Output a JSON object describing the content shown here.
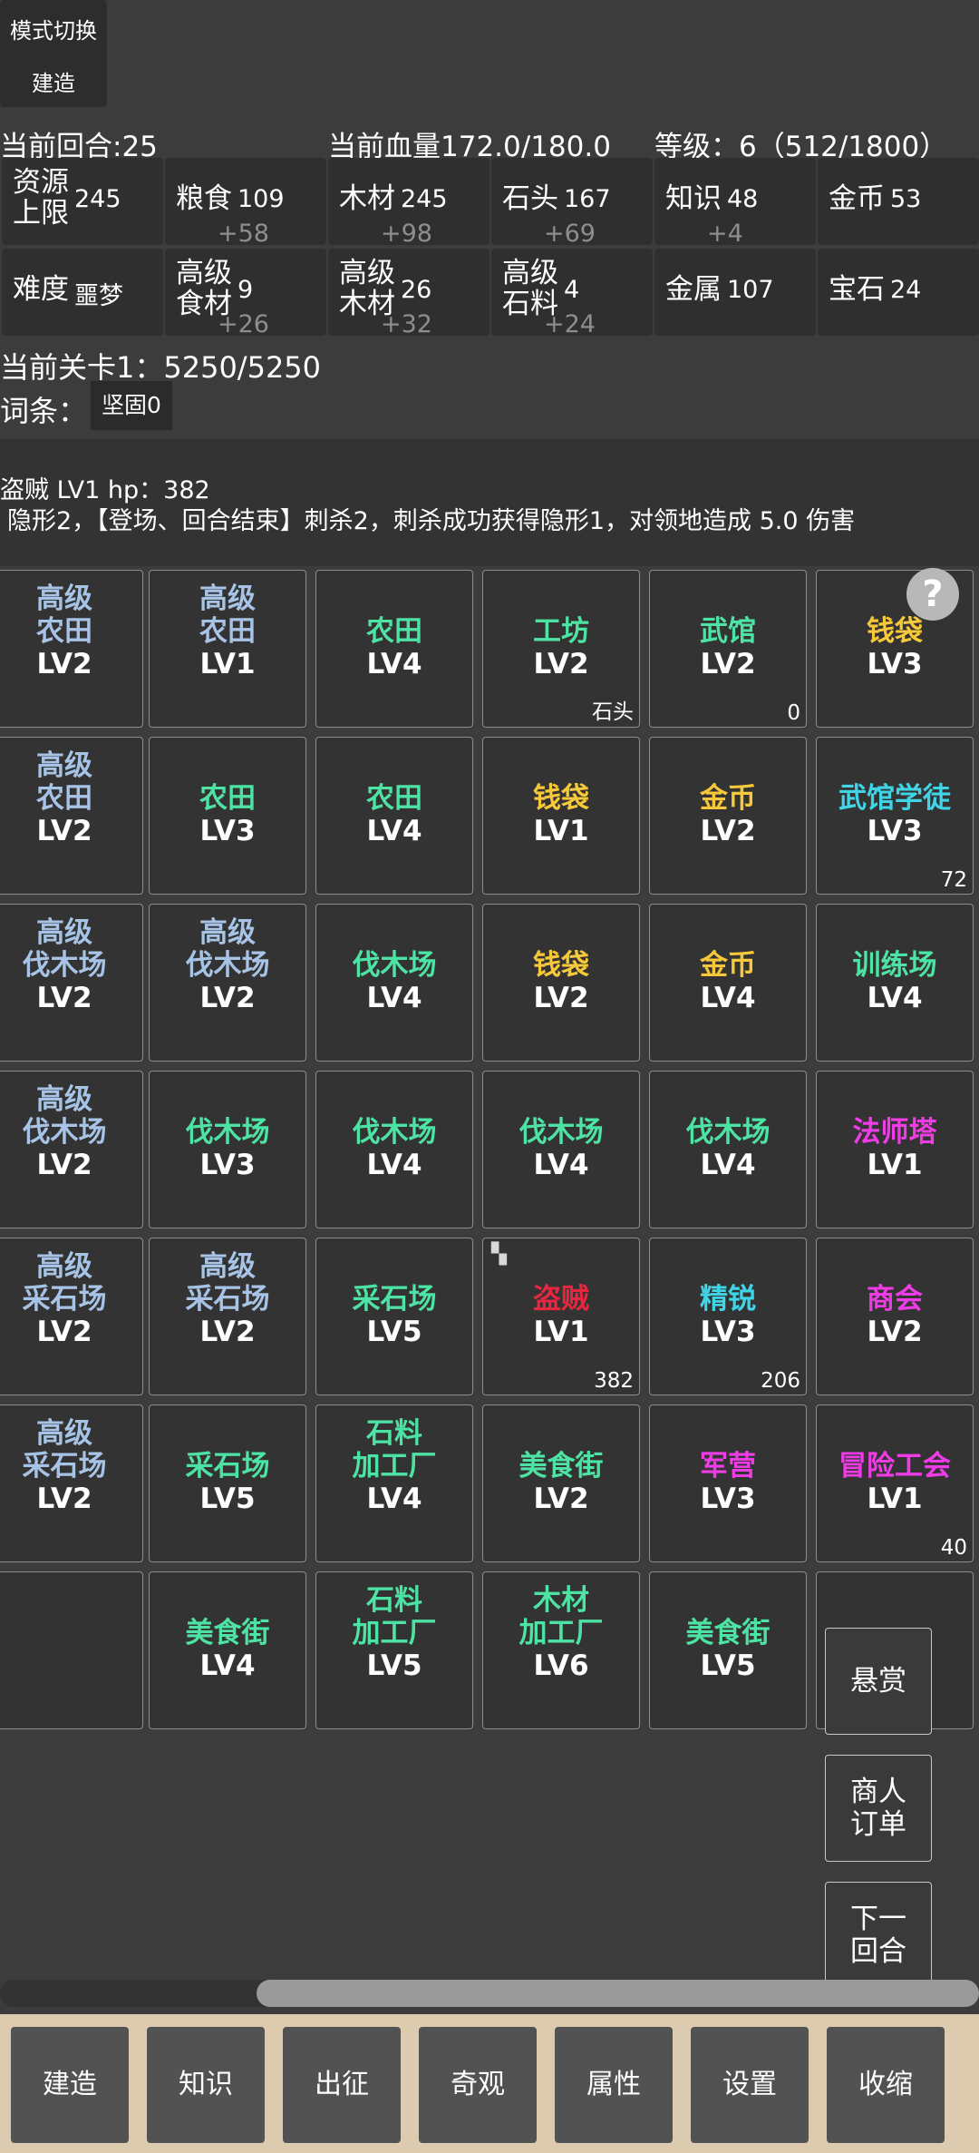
{
  "mode_panel": {
    "title": "模式切换",
    "mode": "建造"
  },
  "status": {
    "round": "当前回合:25",
    "hp": "当前血量172.0/180.0",
    "level": "等级：6（512/1800）"
  },
  "resources": {
    "row1": [
      {
        "label_l1": "资源",
        "label_l2": "上限",
        "value": "245",
        "delta": ""
      },
      {
        "label_l1": "粮食",
        "label_l2": "",
        "value": "109",
        "delta": "+58"
      },
      {
        "label_l1": "木材",
        "label_l2": "",
        "value": "245",
        "delta": "+98"
      },
      {
        "label_l1": "石头",
        "label_l2": "",
        "value": "167",
        "delta": "+69"
      },
      {
        "label_l1": "知识",
        "label_l2": "",
        "value": "48",
        "delta": "+4"
      },
      {
        "label_l1": "金币",
        "label_l2": "",
        "value": "53",
        "delta": ""
      }
    ],
    "row2": [
      {
        "label_l1": "难度",
        "label_l2": "",
        "value": "噩梦",
        "delta": ""
      },
      {
        "label_l1": "高级",
        "label_l2": "食材",
        "value": "9",
        "delta": "+26"
      },
      {
        "label_l1": "高级",
        "label_l2": "木材",
        "value": "26",
        "delta": "+32"
      },
      {
        "label_l1": "高级",
        "label_l2": "石料",
        "value": "4",
        "delta": "+24"
      },
      {
        "label_l1": "金属",
        "label_l2": "",
        "value": "107",
        "delta": ""
      },
      {
        "label_l1": "宝石",
        "label_l2": "",
        "value": "24",
        "delta": ""
      }
    ]
  },
  "stage": {
    "label": "当前关卡1：5250/5250",
    "terms_label": "词条：",
    "term": "坚固0"
  },
  "enemy": {
    "title": "盗贼 LV1 hp：382",
    "desc": "隐形2，【登场、回合结束】刺杀2，刺杀成功获得隐形1，对领地造成 5.0 伤害"
  },
  "help_icon": "question-icon",
  "colors": {
    "blue": "#a7c3e6",
    "green": "#4de3a4",
    "cyan": "#3fd4e6",
    "yellow": "#f7c93a",
    "magenta": "#f03ce6",
    "red": "#e7263f",
    "bottom_bar": "#dccbae"
  },
  "grid": {
    "rows": [
      [
        {
          "l1": "高级",
          "l2": "农田",
          "lv": "LV2",
          "color": "blue",
          "badge": ""
        },
        {
          "l1": "高级",
          "l2": "农田",
          "lv": "LV1",
          "color": "blue",
          "badge": ""
        },
        {
          "l1": "",
          "l2": "农田",
          "lv": "LV4",
          "color": "green",
          "badge": ""
        },
        {
          "l1": "",
          "l2": "工坊",
          "lv": "LV2",
          "color": "green",
          "badge": "石头"
        },
        {
          "l1": "",
          "l2": "武馆",
          "lv": "LV2",
          "color": "green",
          "badge": "0"
        },
        {
          "l1": "",
          "l2": "钱袋",
          "lv": "LV3",
          "color": "yellow",
          "badge": ""
        }
      ],
      [
        {
          "l1": "高级",
          "l2": "农田",
          "lv": "LV2",
          "color": "blue",
          "badge": ""
        },
        {
          "l1": "",
          "l2": "农田",
          "lv": "LV3",
          "color": "green",
          "badge": ""
        },
        {
          "l1": "",
          "l2": "农田",
          "lv": "LV4",
          "color": "green",
          "badge": ""
        },
        {
          "l1": "",
          "l2": "钱袋",
          "lv": "LV1",
          "color": "yellow",
          "badge": ""
        },
        {
          "l1": "",
          "l2": "金币",
          "lv": "LV2",
          "color": "yellow",
          "badge": ""
        },
        {
          "l1": "",
          "l2": "武馆学徒",
          "lv": "LV3",
          "color": "cyan",
          "badge": "72"
        }
      ],
      [
        {
          "l1": "高级",
          "l2": "伐木场",
          "lv": "LV2",
          "color": "blue",
          "badge": ""
        },
        {
          "l1": "高级",
          "l2": "伐木场",
          "lv": "LV2",
          "color": "blue",
          "badge": ""
        },
        {
          "l1": "",
          "l2": "伐木场",
          "lv": "LV4",
          "color": "green",
          "badge": ""
        },
        {
          "l1": "",
          "l2": "钱袋",
          "lv": "LV2",
          "color": "yellow",
          "badge": ""
        },
        {
          "l1": "",
          "l2": "金币",
          "lv": "LV4",
          "color": "yellow",
          "badge": ""
        },
        {
          "l1": "",
          "l2": "训练场",
          "lv": "LV4",
          "color": "green",
          "badge": ""
        }
      ],
      [
        {
          "l1": "高级",
          "l2": "伐木场",
          "lv": "LV2",
          "color": "blue",
          "badge": ""
        },
        {
          "l1": "",
          "l2": "伐木场",
          "lv": "LV3",
          "color": "green",
          "badge": ""
        },
        {
          "l1": "",
          "l2": "伐木场",
          "lv": "LV4",
          "color": "green",
          "badge": ""
        },
        {
          "l1": "",
          "l2": "伐木场",
          "lv": "LV4",
          "color": "green",
          "badge": ""
        },
        {
          "l1": "",
          "l2": "伐木场",
          "lv": "LV4",
          "color": "green",
          "badge": ""
        },
        {
          "l1": "",
          "l2": "法师塔",
          "lv": "LV1",
          "color": "magenta",
          "badge": ""
        }
      ],
      [
        {
          "l1": "高级",
          "l2": "采石场",
          "lv": "LV2",
          "color": "blue",
          "badge": ""
        },
        {
          "l1": "高级",
          "l2": "采石场",
          "lv": "LV2",
          "color": "blue",
          "badge": ""
        },
        {
          "l1": "",
          "l2": "采石场",
          "lv": "LV5",
          "color": "green",
          "badge": ""
        },
        {
          "l1": "",
          "l2": "盗贼",
          "lv": "LV1",
          "color": "red",
          "badge": "382"
        },
        {
          "l1": "",
          "l2": "精锐",
          "lv": "LV3",
          "color": "cyan",
          "badge": "206"
        },
        {
          "l1": "",
          "l2": "商会",
          "lv": "LV2",
          "color": "magenta",
          "badge": ""
        }
      ],
      [
        {
          "l1": "高级",
          "l2": "采石场",
          "lv": "LV2",
          "color": "blue",
          "badge": ""
        },
        {
          "l1": "",
          "l2": "采石场",
          "lv": "LV5",
          "color": "green",
          "badge": ""
        },
        {
          "l1": "石料",
          "l2": "加工厂",
          "lv": "LV4",
          "color": "green",
          "badge": ""
        },
        {
          "l1": "",
          "l2": "美食街",
          "lv": "LV2",
          "color": "green",
          "badge": ""
        },
        {
          "l1": "",
          "l2": "军营",
          "lv": "LV3",
          "color": "magenta",
          "badge": ""
        },
        {
          "l1": "",
          "l2": "冒险工会",
          "lv": "LV1",
          "color": "magenta",
          "badge": "40"
        }
      ],
      [
        {
          "l1": "",
          "l2": "",
          "lv": "",
          "color": "green",
          "badge": ""
        },
        {
          "l1": "",
          "l2": "美食街",
          "lv": "LV4",
          "color": "green",
          "badge": ""
        },
        {
          "l1": "石料",
          "l2": "加工厂",
          "lv": "LV5",
          "color": "green",
          "badge": ""
        },
        {
          "l1": "木材",
          "l2": "加工厂",
          "lv": "LV6",
          "color": "green",
          "badge": ""
        },
        {
          "l1": "",
          "l2": "美食街",
          "lv": "LV5",
          "color": "green",
          "badge": ""
        },
        {
          "l1": "",
          "l2": "",
          "lv": "",
          "color": "magenta",
          "badge": ""
        }
      ]
    ]
  },
  "side_buttons": [
    {
      "l1": "悬赏",
      "l2": ""
    },
    {
      "l1": "商人",
      "l2": "订单"
    },
    {
      "l1": "下一",
      "l2": "回合"
    }
  ],
  "bottom_bar": [
    "建造",
    "知识",
    "出征",
    "奇观",
    "属性",
    "设置",
    "收缩"
  ]
}
